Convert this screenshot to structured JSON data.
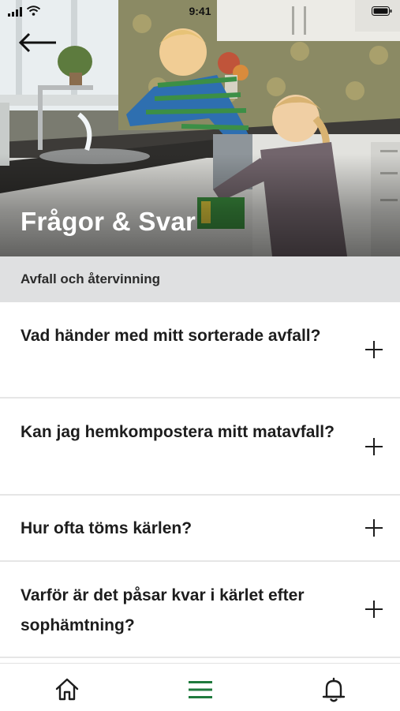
{
  "status_bar": {
    "time": "9:41"
  },
  "header": {
    "back_icon": "arrow-left-icon",
    "title": "Frågor & Svar"
  },
  "section": {
    "label": "Avfall och återvinning"
  },
  "faq": {
    "items": [
      {
        "question": "Vad händer med mitt sorterade avfall?",
        "icon": "plus-icon",
        "expanded": false
      },
      {
        "question": "Kan jag hemkompostera mitt matavfall?",
        "icon": "plus-icon",
        "expanded": false
      },
      {
        "question": "Hur ofta töms kärlen?",
        "icon": "plus-icon",
        "expanded": false
      },
      {
        "question": "Varför är det påsar kvar i kärlet efter sophämtning?",
        "icon": "plus-icon",
        "expanded": false
      }
    ]
  },
  "tab_bar": {
    "tabs": [
      {
        "icon": "home-icon",
        "active": false
      },
      {
        "icon": "menu-icon",
        "active": true
      },
      {
        "icon": "bell-icon",
        "active": false
      }
    ]
  },
  "colors": {
    "accent": "#1f7a3d",
    "section_background": "#dfe0e1",
    "text": "#1d1d1d",
    "divider": "#e6e6e6"
  }
}
